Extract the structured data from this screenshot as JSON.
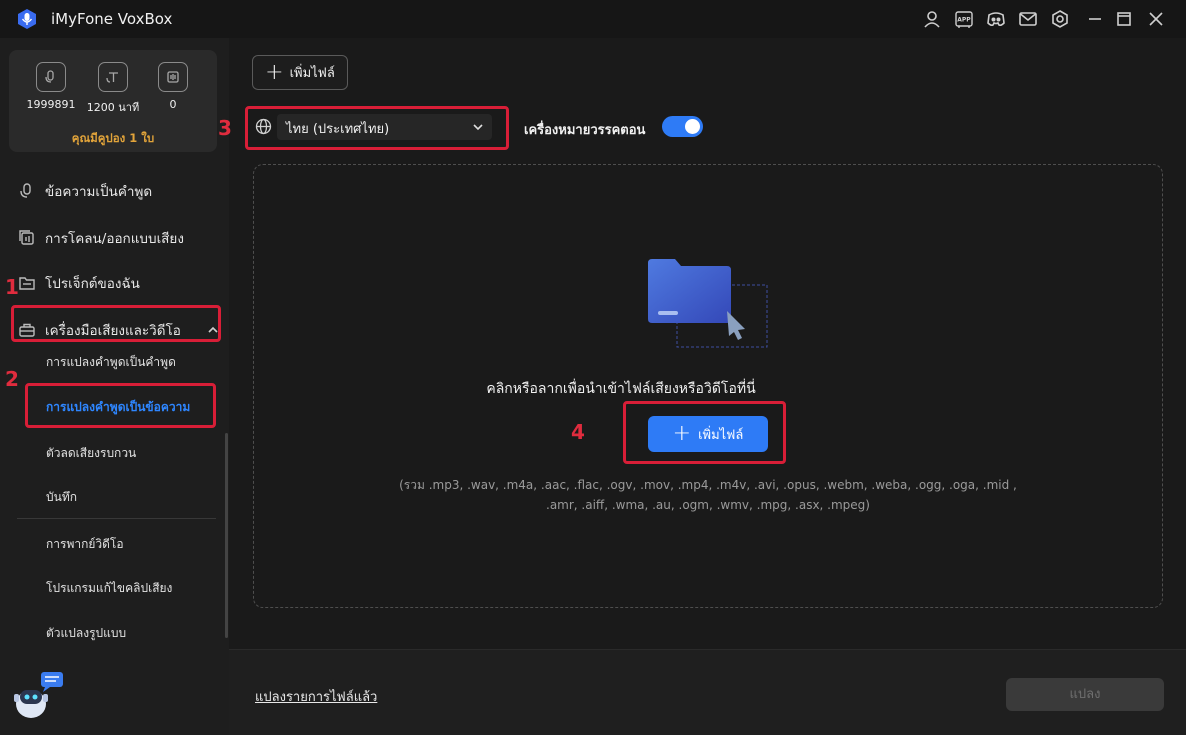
{
  "app": {
    "title": "iMyFone VoxBox"
  },
  "titlebar": {
    "icons": [
      "user-icon",
      "app-icon",
      "discord-icon",
      "mail-icon",
      "settings-icon",
      "minimize-icon",
      "maximize-icon",
      "close-icon"
    ],
    "app_badge": "APP"
  },
  "sidebar": {
    "stats": [
      {
        "icon": "voice-icon",
        "value": "1999891"
      },
      {
        "icon": "text-icon",
        "value": "1200 นาที"
      },
      {
        "icon": "clone-icon",
        "value": "0"
      }
    ],
    "coupon": "คุณมีคูปอง 1 ใบ",
    "nav": [
      {
        "icon": "microphone-icon",
        "label": "ข้อความเป็นคำพูด"
      },
      {
        "icon": "clone-voice-icon",
        "label": "การโคลน/ออกแบบเสียง"
      },
      {
        "icon": "folder-icon",
        "label": "โปรเจ็กต์ของฉัน"
      },
      {
        "icon": "toolbox-icon",
        "label": "เครื่องมือเสียงและวิดีโอ"
      }
    ],
    "subnav": [
      {
        "label": "การแปลงคำพูดเป็นคำพูด",
        "active": false
      },
      {
        "label": "การแปลงคำพูดเป็นข้อความ",
        "active": true
      },
      {
        "label": "ตัวลดเสียงรบกวน",
        "active": false
      },
      {
        "label": "บันทึก",
        "active": false
      },
      {
        "label": "การพากย์วิดีโอ",
        "active": false
      },
      {
        "label": "โปรแกรมแก้ไขคลิปเสียง",
        "active": false
      },
      {
        "label": "ตัวแปลงรูปแบบ",
        "active": false
      }
    ]
  },
  "annotations": [
    "1",
    "2",
    "3",
    "4"
  ],
  "main": {
    "add_file_label": "เพิ่มไฟล์",
    "language": {
      "selected": "ไทย (ประเทศไทย)"
    },
    "punctuation": {
      "label": "เครื่องหมายวรรคตอน",
      "enabled": true
    },
    "dropzone": {
      "prompt": "คลิกหรือลากเพื่อนำเข้าไฟล์เสียงหรือวิดีโอที่นี่",
      "add_button": "เพิ่มไฟล์",
      "formats_line1": "(รวม .mp3, .wav, .m4a, .aac, .flac, .ogv, .mov, .mp4, .m4v, .avi, .opus, .webm, .weba, .ogg, .oga, .mid ,",
      "formats_line2": ".amr, .aiff, .wma, .au, .ogm, .wmv, .mpg, .asx, .mpeg)"
    }
  },
  "footer": {
    "converted_link": "แปลงรายการไฟล์แล้ว",
    "convert_button": "แปลง"
  },
  "colors": {
    "accent": "#2e7bf6",
    "active_nav": "#2e86ff",
    "coupon": "#e2a43a",
    "annotation": "#d81e37"
  }
}
